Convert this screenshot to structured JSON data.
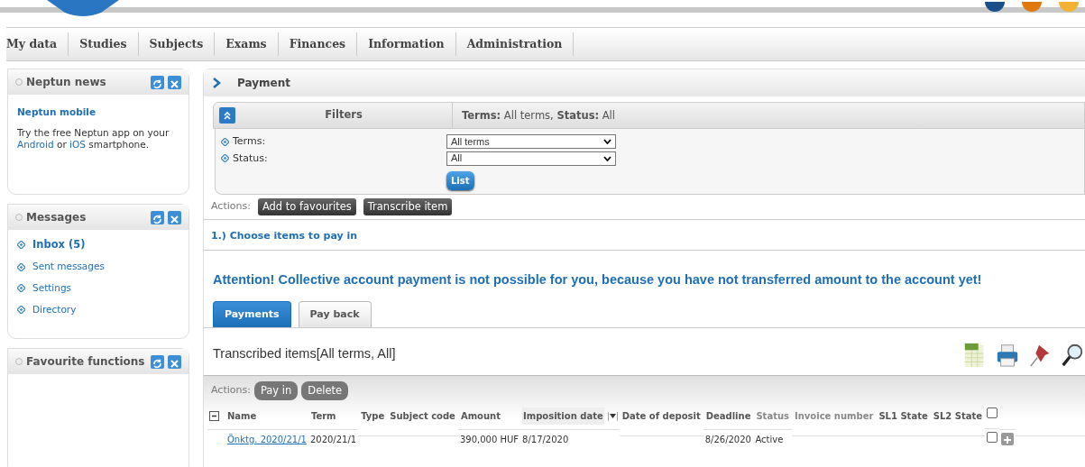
{
  "menu": [
    {
      "label": "My data"
    },
    {
      "label": "Studies"
    },
    {
      "label": "Subjects"
    },
    {
      "label": "Exams"
    },
    {
      "label": "Finances"
    },
    {
      "label": "Information"
    },
    {
      "label": "Administration"
    }
  ],
  "sidebar": [
    {
      "title": "Neptun news",
      "kind": "news",
      "heading": "Neptun mobile",
      "parts": [
        {
          "kind": "text",
          "text": "Try the free Neptun app on your"
        },
        {
          "kind": "link",
          "text": "Android"
        },
        {
          "kind": "text",
          "text": "or"
        },
        {
          "kind": "link",
          "text": "iOS"
        },
        {
          "kind": "text",
          "text": "smartphone."
        }
      ]
    },
    {
      "title": "Messages",
      "kind": "links",
      "items": [
        {
          "label": "Inbox (5)",
          "bold": true
        },
        {
          "label": "Sent messages",
          "bold": false
        },
        {
          "label": "Settings",
          "bold": false
        },
        {
          "label": "Directory",
          "bold": false
        }
      ]
    },
    {
      "title": "Favourite functions",
      "kind": "empty"
    }
  ],
  "page_title": "Payment",
  "filters": {
    "title": "Filters",
    "expanded": true,
    "summary": "**Terms:** All terms, **Status:** All",
    "fields": [
      {
        "label": "Terms:",
        "value": "All terms"
      },
      {
        "label": "Status:",
        "value": "All"
      }
    ],
    "button": "List"
  },
  "actions_label": "Actions:",
  "actions": [
    "Add to favourites",
    "Transcribe item"
  ],
  "step": "1.) Choose items to pay in",
  "attention": "Attention! Collective account payment is not possible for you, because you have not transferred amount to the account yet!",
  "tabs": [
    {
      "label": "Payments",
      "selected": true
    },
    {
      "label": "Pay back",
      "selected": false
    }
  ],
  "list_title": "Transcribed items[All terms, All]",
  "table": {
    "actions_label": "Actions:",
    "actions": [
      "Pay in",
      "Delete"
    ],
    "columns": [
      {
        "label": "Name",
        "muted": false,
        "sorted": false
      },
      {
        "label": "Term",
        "muted": false,
        "sorted": false
      },
      {
        "label": "Type",
        "muted": false,
        "sorted": false
      },
      {
        "label": "Subject code",
        "muted": false,
        "sorted": false
      },
      {
        "label": "Amount",
        "muted": false,
        "sorted": false
      },
      {
        "label": "Imposition date",
        "muted": false,
        "sorted": true
      },
      {
        "label": "Date of deposit",
        "muted": false,
        "sorted": false
      },
      {
        "label": "Deadline",
        "muted": false,
        "sorted": false
      },
      {
        "label": "Status",
        "muted": true,
        "sorted": false
      },
      {
        "label": "Invoice number",
        "muted": true,
        "sorted": false
      },
      {
        "label": "SL1 State",
        "muted": false,
        "sorted": false
      },
      {
        "label": "SL2 State",
        "muted": false,
        "sorted": false
      }
    ],
    "all_checked": false,
    "rows": [
      {
        "cells": [
          "Önktg. 2020/21/1",
          "2020/21/1",
          "",
          "",
          "390,000 HUF",
          "8/17/2020",
          "",
          "8/26/2020",
          "Active",
          "",
          "",
          ""
        ],
        "checked": false
      }
    ]
  }
}
